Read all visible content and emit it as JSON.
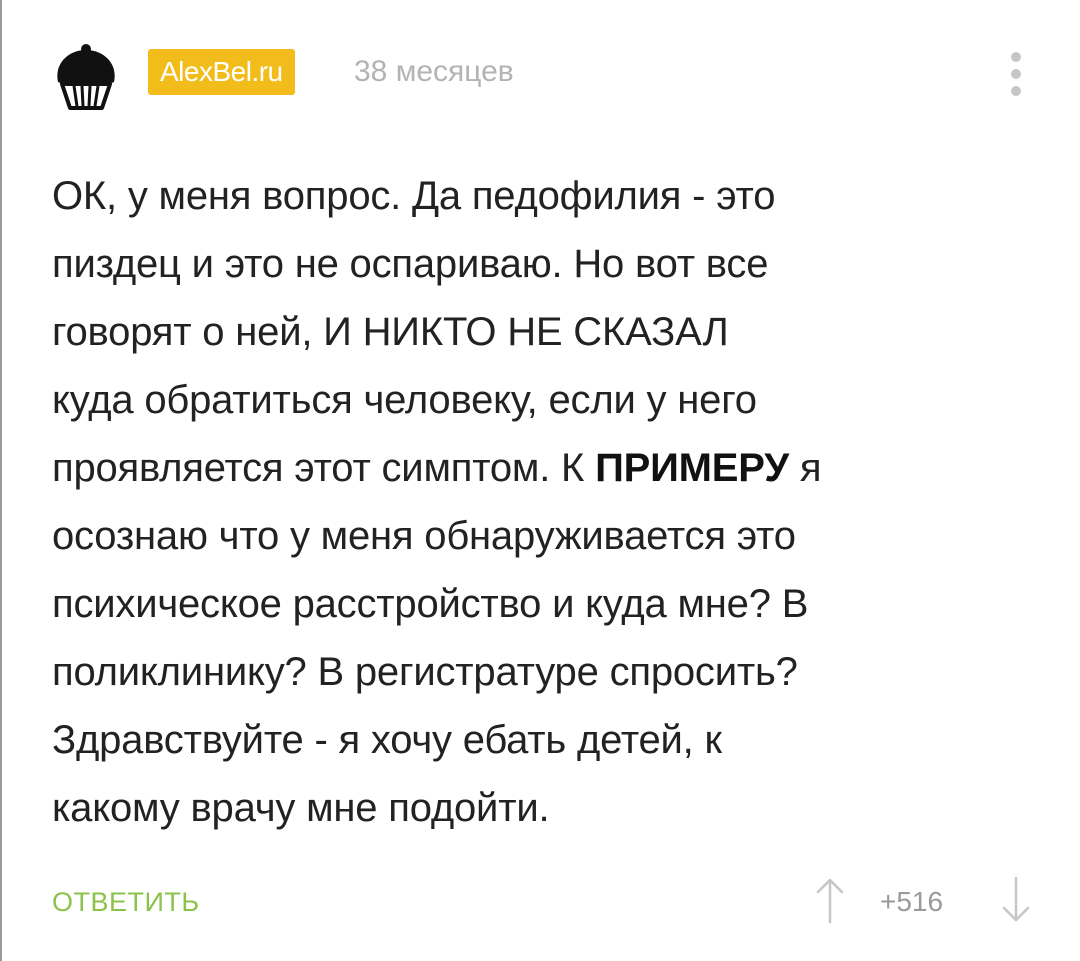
{
  "comment": {
    "author": {
      "username": "AlexBel.ru",
      "avatar_icon": "muffin-icon",
      "badge_color": "#f2bc1a"
    },
    "timestamp": "38 месяцев",
    "menu_icon": "more-vertical-icon",
    "body": {
      "line1": "ОК, у меня вопрос. Да педофилия - это",
      "line2": "пиздец и это не оспариваю. Но вот все",
      "line3": "говорят о ней, И НИКТО НЕ СКАЗАЛ",
      "line4": "куда обратиться человеку, если у него",
      "line5_before": "проявляется этот симптом. К ",
      "line5_bold": "ПРИМЕРУ",
      "line5_after": " я",
      "line6": "осознаю что у меня обнаруживается это",
      "line7": "психическое расстройство и куда мне? В",
      "line8": "поликлинику? В регистратуре спросить?",
      "line9": "Здравствуйте - я хочу ебать детей, к",
      "line10": "какому врачу мне подойти."
    },
    "actions": {
      "reply_label": "ОТВЕТИТЬ",
      "reply_color": "#8bc34a",
      "rating": "+516",
      "upvote_icon": "arrow-up-icon",
      "downvote_icon": "arrow-down-icon"
    }
  }
}
